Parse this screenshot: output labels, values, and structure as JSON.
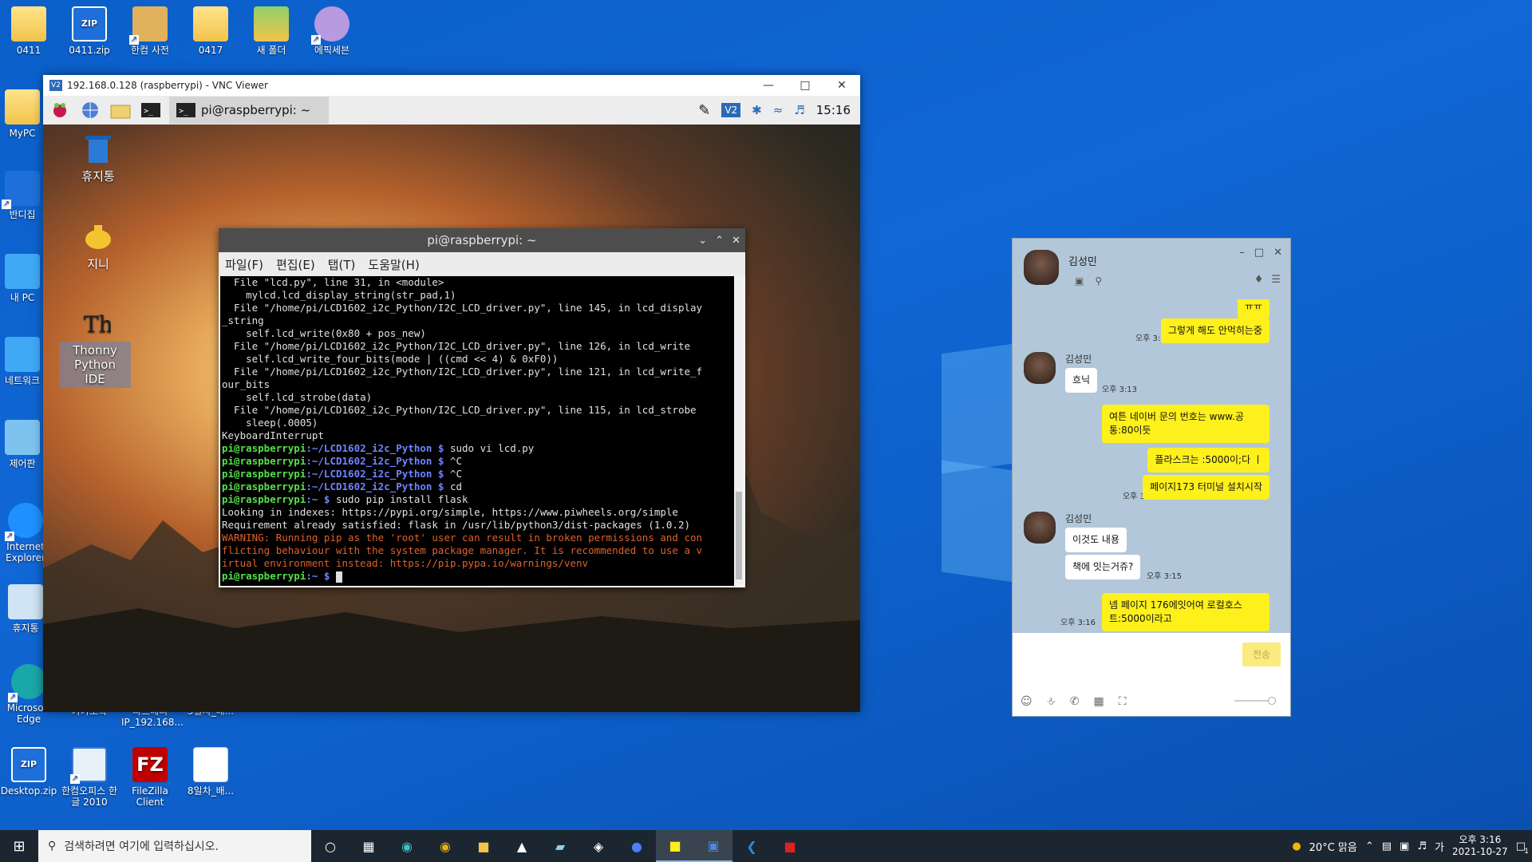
{
  "desktop": {
    "icons": [
      {
        "label": "0411"
      },
      {
        "label": "0411.zip"
      },
      {
        "label": "한컴 사전"
      },
      {
        "label": "0417"
      },
      {
        "label": "새 폴더"
      },
      {
        "label": "에픽세븐"
      },
      {
        "label": "MyPC"
      },
      {
        "label": "반디집"
      },
      {
        "label": "내 PC"
      },
      {
        "label": "네트워크"
      },
      {
        "label": "제어판"
      },
      {
        "label": "Internet Explorer"
      },
      {
        "label": "휴지통"
      },
      {
        "label": "Microsoft Edge"
      },
      {
        "label": "카카오톡"
      },
      {
        "label": "라즈베리 IP_192.168..."
      },
      {
        "label": "5일차_배..."
      },
      {
        "label": "Desktop.zip"
      },
      {
        "label": "한컴오피스 한글 2010"
      },
      {
        "label": "FileZilla Client"
      },
      {
        "label": "8일차_배..."
      }
    ]
  },
  "vnc": {
    "title": "192.168.0.128 (raspberrypi) - VNC Viewer",
    "panel": {
      "task_label": "pi@raspberrypi: ~",
      "clock": "15:16"
    },
    "pi_desktop": [
      {
        "label": "휴지통"
      },
      {
        "label": "지니"
      },
      {
        "label": "Thonny Python IDE"
      }
    ],
    "terminal": {
      "title": "pi@raspberrypi: ~",
      "menu": [
        "파일(F)",
        "편집(E)",
        "탭(T)",
        "도움말(H)"
      ],
      "lines": [
        "  File \"lcd.py\", line 31, in <module>",
        "    mylcd.lcd_display_string(str_pad,1)",
        "  File \"/home/pi/LCD1602_i2c_Python/I2C_LCD_driver.py\", line 145, in lcd_display",
        "_string",
        "    self.lcd_write(0x80 + pos_new)",
        "  File \"/home/pi/LCD1602_i2c_Python/I2C_LCD_driver.py\", line 126, in lcd_write",
        "    self.lcd_write_four_bits(mode | ((cmd << 4) & 0xF0))",
        "  File \"/home/pi/LCD1602_i2c_Python/I2C_LCD_driver.py\", line 121, in lcd_write_f",
        "our_bits",
        "    self.lcd_strobe(data)",
        "  File \"/home/pi/LCD1602_i2c_Python/I2C_LCD_driver.py\", line 115, in lcd_strobe",
        "    sleep(.0005)",
        "KeyboardInterrupt"
      ],
      "prompts": [
        {
          "user": "pi@raspberrypi",
          "path": ":~/LCD1602_i2c_Python $",
          "cmd": " sudo vi lcd.py"
        },
        {
          "user": "pi@raspberrypi",
          "path": ":~/LCD1602_i2c_Python $",
          "cmd": " ^C"
        },
        {
          "user": "pi@raspberrypi",
          "path": ":~/LCD1602_i2c_Python $",
          "cmd": " ^C"
        },
        {
          "user": "pi@raspberrypi",
          "path": ":~/LCD1602_i2c_Python $",
          "cmd": " cd"
        },
        {
          "user": "pi@raspberrypi",
          "path": ":~ $",
          "cmd": " sudo pip install flask"
        }
      ],
      "output": [
        "Looking in indexes: https://pypi.org/simple, https://www.piwheels.org/simple",
        "Requirement already satisfied: flask in /usr/lib/python3/dist-packages (1.0.2)"
      ],
      "warning": [
        "WARNING: Running pip as the 'root' user can result in broken permissions and con",
        "flicting behaviour with the system package manager. It is recommended to use a v",
        "irtual environment instead: https://pip.pypa.io/warnings/venv"
      ],
      "last_prompt": {
        "user": "pi@raspberrypi",
        "path": ":~ $",
        "cmd": " "
      }
    }
  },
  "kakao": {
    "contact": "김성민",
    "messages": [
      {
        "text": "ㅠㅠ",
        "time": ""
      },
      {
        "text": "그렇게 해도 안먹히는중",
        "time": "오후 3:13"
      },
      {
        "sender": "김성민",
        "text": "흐닉",
        "time": "오후 3:13"
      },
      {
        "text": "여튼 네이버 문의 번호는 www.공통:80이듯",
        "time": ""
      },
      {
        "text": "플라스크는 :5000이;다 ㅣ",
        "time": ""
      },
      {
        "text": "페이지173 터미널 설치시작",
        "time": "오후 3:14"
      },
      {
        "sender": "김성민",
        "text": "이것도 내용",
        "time": ""
      },
      {
        "text": "책에 잇는거쥬?",
        "time": "오후 3:15"
      },
      {
        "text": "넴 페이지 176에잇어여 로컬호스트:5000이라고",
        "time": "오후 3:16"
      }
    ],
    "send_label": "전송"
  },
  "taskbar": {
    "search_placeholder": "검색하려면 여기에 입력하십시오.",
    "weather": "20°C  맑음",
    "ime": "가",
    "time": "오후 3:16",
    "date": "2021-10-27",
    "notif_count": "1"
  }
}
